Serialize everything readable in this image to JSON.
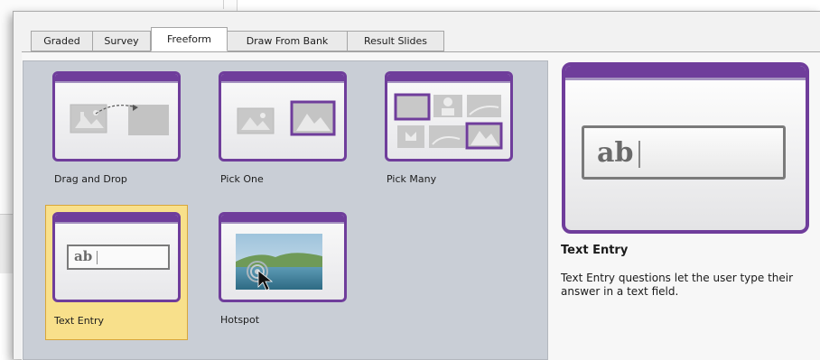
{
  "tabs": [
    {
      "label": "Graded",
      "active": false
    },
    {
      "label": "Survey",
      "active": false
    },
    {
      "label": "Freeform",
      "active": true
    },
    {
      "label": "Draw From Bank",
      "active": false
    },
    {
      "label": "Result Slides",
      "active": false
    }
  ],
  "items": [
    {
      "label": "Drag and Drop",
      "icon": "drag-and-drop-icon",
      "selected": false
    },
    {
      "label": "Pick One",
      "icon": "pick-one-icon",
      "selected": false
    },
    {
      "label": "Pick Many",
      "icon": "pick-many-icon",
      "selected": false
    },
    {
      "label": "Text Entry",
      "icon": "text-entry-icon",
      "selected": true,
      "field_text": "ab"
    },
    {
      "label": "Hotspot",
      "icon": "hotspot-icon",
      "selected": false
    }
  ],
  "preview": {
    "field_text": "ab",
    "title": "Text Entry",
    "description": "Text Entry questions let the user type their answer in a text field."
  },
  "colors": {
    "accent": "#6f3d9b",
    "accent_light": "#a593c0",
    "selection": "#f8e08b",
    "grid_bg": "#c9ced6"
  }
}
